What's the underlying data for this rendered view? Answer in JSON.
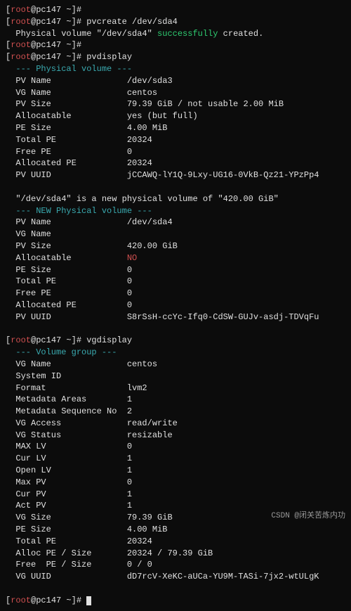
{
  "prompt": {
    "user": "root",
    "host": "pc147",
    "cwd": "~",
    "sym": "#"
  },
  "cmd1": "pvcreate /dev/sda4",
  "pvcreate_msg": {
    "pre": "  Physical volume \"/dev/sda4\" ",
    "ok": "successfully",
    "post": " created."
  },
  "cmd_blank": "",
  "cmd2": "pvdisplay",
  "pv_header": "  --- Physical volume ---",
  "pv1": [
    {
      "k": "PV Name",
      "v": "/dev/sda3"
    },
    {
      "k": "VG Name",
      "v": "centos"
    },
    {
      "k": "PV Size",
      "v": "79.39 GiB / not usable 2.00 MiB"
    },
    {
      "k": "Allocatable",
      "v": "yes (but full)"
    },
    {
      "k": "PE Size",
      "v": "4.00 MiB"
    },
    {
      "k": "Total PE",
      "v": "20324"
    },
    {
      "k": "Free PE",
      "v": "0"
    },
    {
      "k": "Allocated PE",
      "v": "20324"
    },
    {
      "k": "PV UUID",
      "v": "jCCAWQ-lY1Q-9Lxy-UG16-0VkB-Qz21-YPzPp4"
    }
  ],
  "new_pv_note": "  \"/dev/sda4\" is a new physical volume of \"420.00 GiB\"",
  "new_pv_header": "  --- NEW Physical volume ---",
  "pv2": [
    {
      "k": "PV Name",
      "v": "/dev/sda4"
    },
    {
      "k": "VG Name",
      "v": ""
    },
    {
      "k": "PV Size",
      "v": "420.00 GiB"
    },
    {
      "k": "Allocatable",
      "v": "NO",
      "red": true
    },
    {
      "k": "PE Size",
      "v": "0"
    },
    {
      "k": "Total PE",
      "v": "0"
    },
    {
      "k": "Free PE",
      "v": "0"
    },
    {
      "k": "Allocated PE",
      "v": "0"
    },
    {
      "k": "PV UUID",
      "v": "S8rSsH-ccYc-Ifq0-CdSW-GUJv-asdj-TDVqFu"
    }
  ],
  "cmd3": "vgdisplay",
  "vg_header": "  --- Volume group ---",
  "vg": [
    {
      "k": "VG Name",
      "v": "centos"
    },
    {
      "k": "System ID",
      "v": ""
    },
    {
      "k": "Format",
      "v": "lvm2"
    },
    {
      "k": "Metadata Areas",
      "v": "1"
    },
    {
      "k": "Metadata Sequence No",
      "v": "2"
    },
    {
      "k": "VG Access",
      "v": "read/write"
    },
    {
      "k": "VG Status",
      "v": "resizable"
    },
    {
      "k": "MAX LV",
      "v": "0"
    },
    {
      "k": "Cur LV",
      "v": "1"
    },
    {
      "k": "Open LV",
      "v": "1"
    },
    {
      "k": "Max PV",
      "v": "0"
    },
    {
      "k": "Cur PV",
      "v": "1"
    },
    {
      "k": "Act PV",
      "v": "1"
    },
    {
      "k": "VG Size",
      "v": "79.39 GiB"
    },
    {
      "k": "PE Size",
      "v": "4.00 MiB"
    },
    {
      "k": "Total PE",
      "v": "20324"
    },
    {
      "k": "Alloc PE / Size",
      "v": "20324 / 79.39 GiB"
    },
    {
      "k": "Free  PE / Size",
      "v": "0 / 0"
    },
    {
      "k": "VG UUID",
      "v": "dD7rcV-XeKC-aUCa-YU9M-TASi-7jx2-wtULgK"
    }
  ],
  "watermark": "CSDN @闭关苦炼内功"
}
